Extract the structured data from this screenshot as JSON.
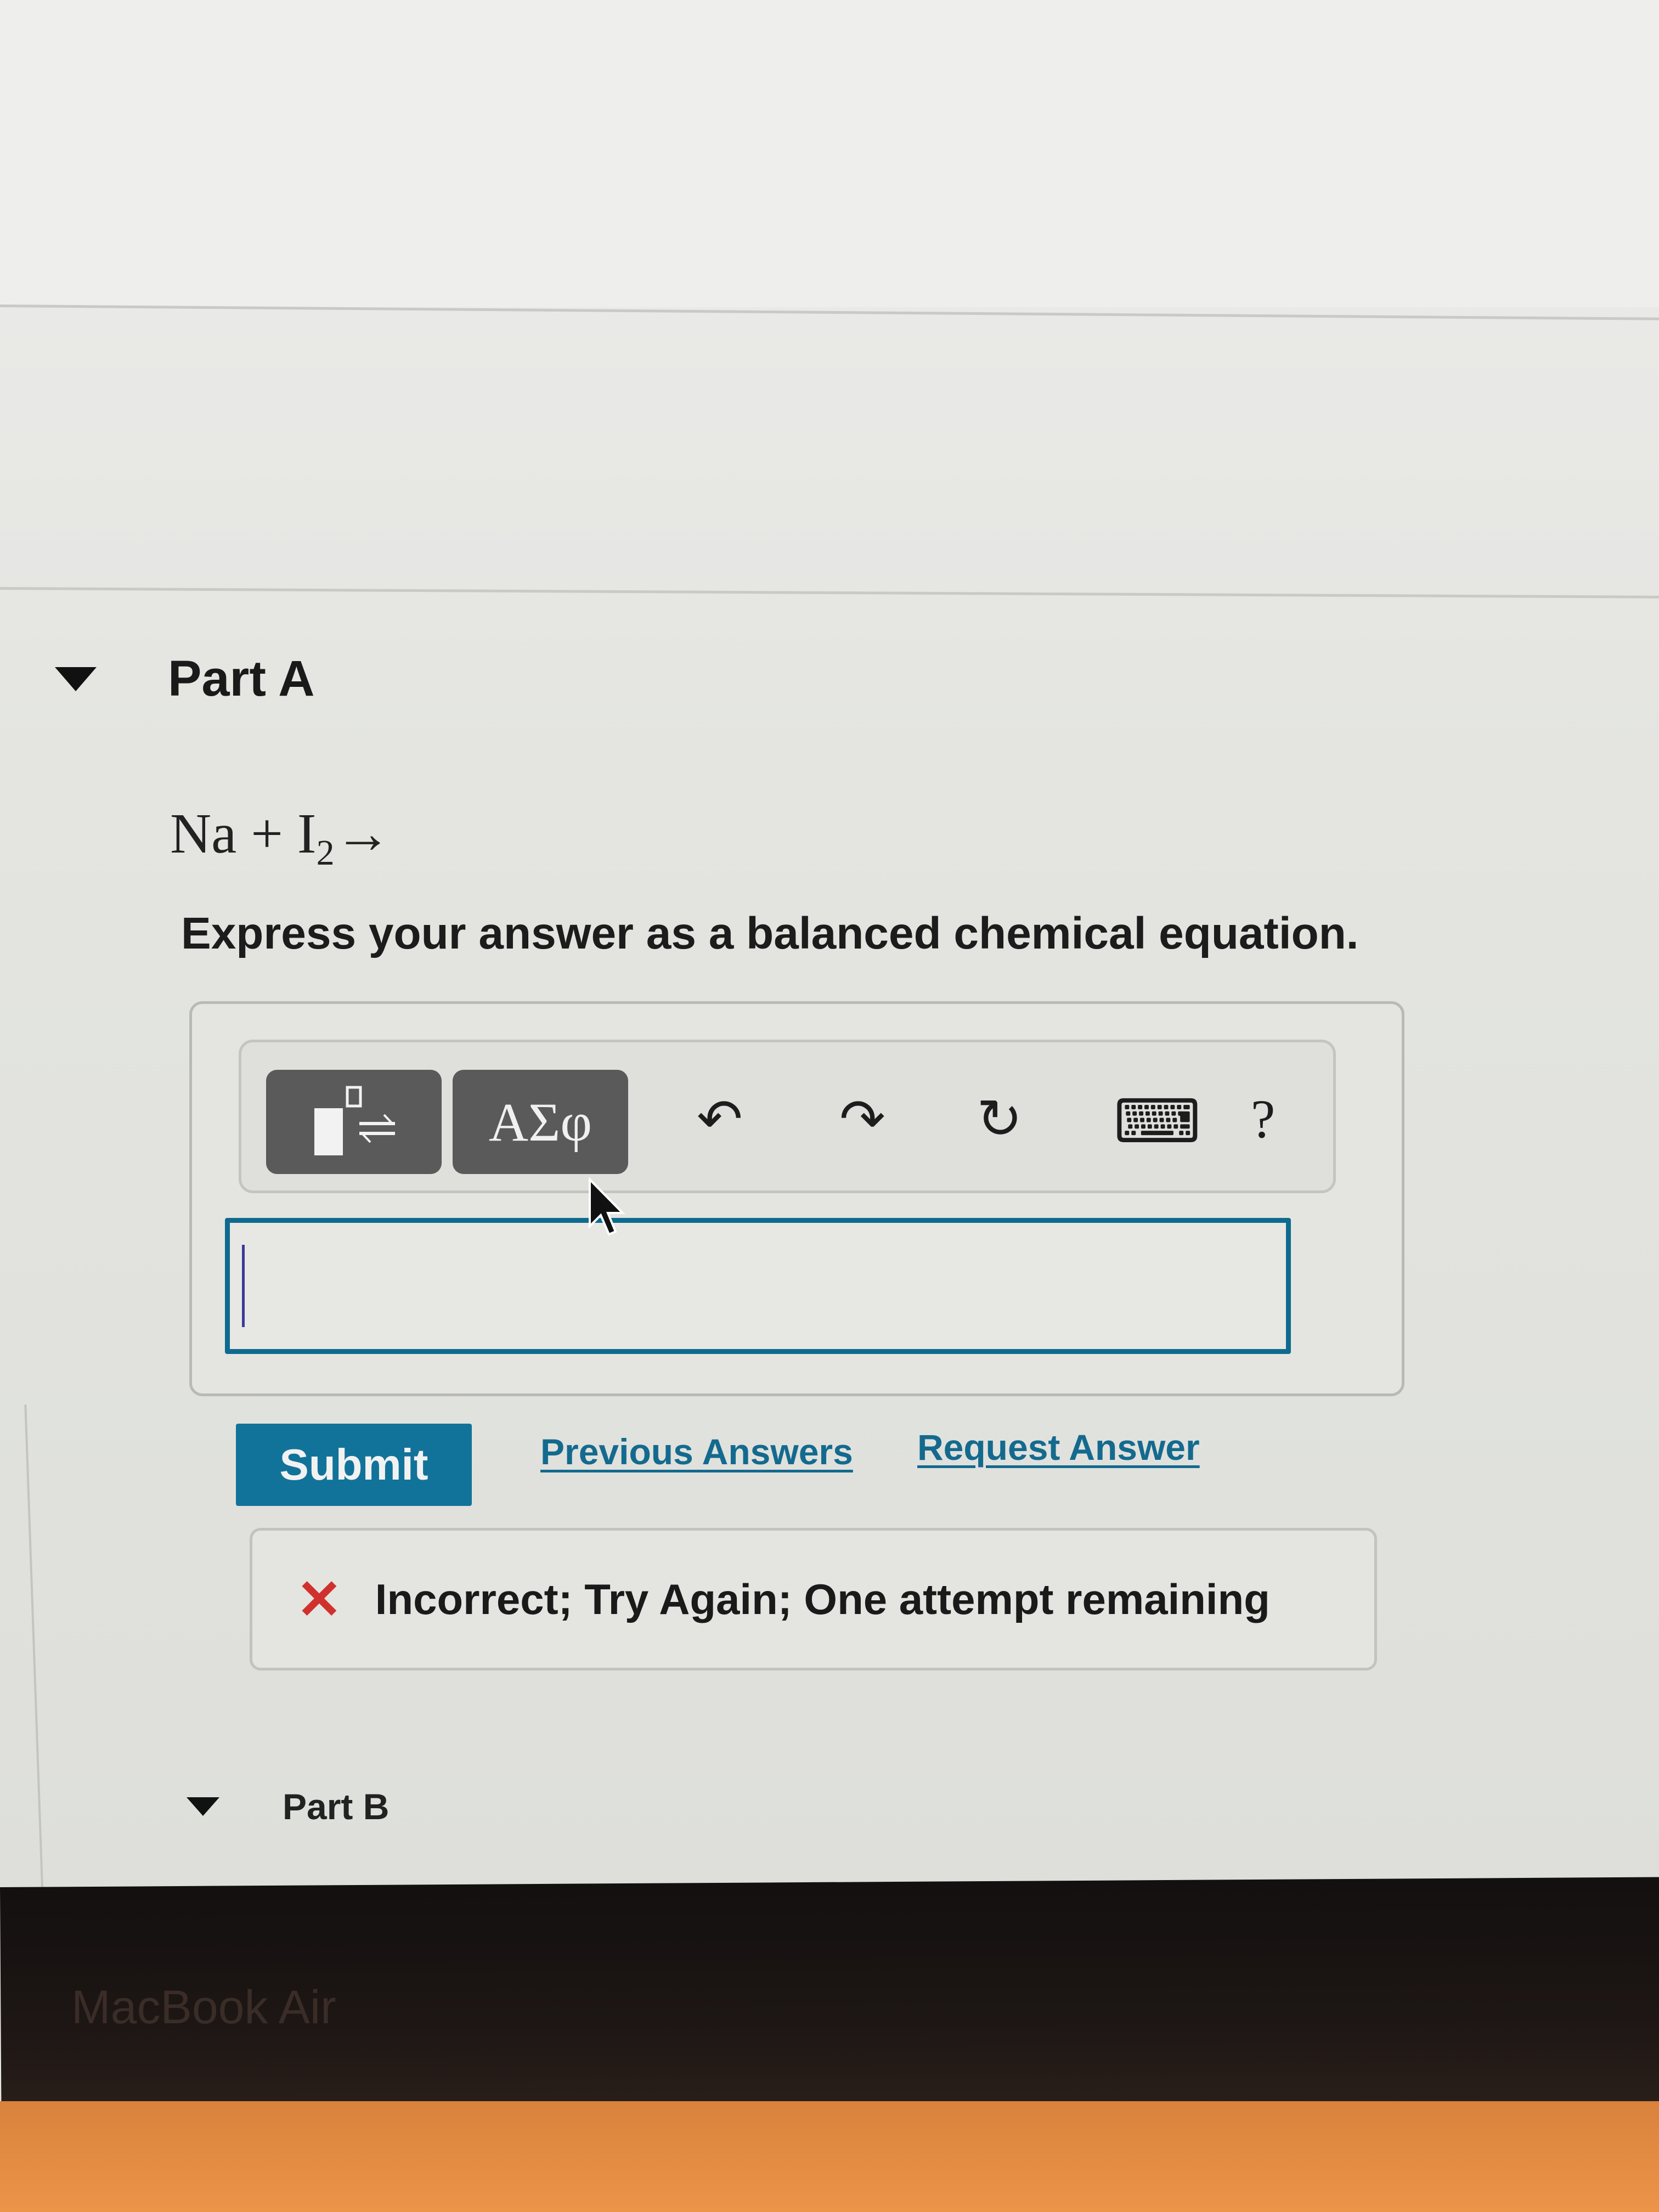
{
  "part_a": {
    "title": "Part A",
    "equation": {
      "reactant1": "Na",
      "plus": "+",
      "reactant2": "I",
      "subscript": "2",
      "arrow": "→"
    },
    "instruction": "Express your answer as a balanced chemical equation."
  },
  "toolbar": {
    "template_button_icon": "template-icon",
    "greek_button_label": "ΑΣφ",
    "undo_icon": "↶",
    "redo_icon": "↷",
    "reset_icon": "↻",
    "keyboard_icon": "⌨",
    "help_icon": "?"
  },
  "answer_input": {
    "value": "",
    "placeholder": ""
  },
  "actions": {
    "submit_label": "Submit",
    "previous_answers_label": "Previous Answers",
    "request_answer_label": "Request Answer"
  },
  "feedback": {
    "icon": "✕",
    "message": "Incorrect; Try Again; One attempt remaining",
    "status_color": "#d0312d"
  },
  "part_b": {
    "title": "Part B"
  },
  "device": {
    "bezel_label": "MacBook Air"
  },
  "colors": {
    "accent": "#12739a",
    "link": "#146a8e",
    "input_border": "#0e6b8e"
  }
}
